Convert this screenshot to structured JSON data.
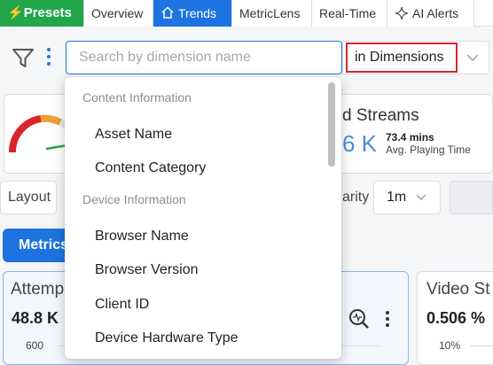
{
  "tabs": {
    "presets": "Presets",
    "overview": "Overview",
    "trends": "Trends",
    "metriclens": "MetricLens",
    "realtime": "Real-Time",
    "aialerts": "AI Alerts"
  },
  "filter": {
    "search_placeholder": "Search by dimension name",
    "search_value": "",
    "scope": "in Dimensions"
  },
  "dropdown": {
    "groups": [
      {
        "label": "Content Information",
        "items": [
          "Asset Name",
          "Content Category"
        ]
      },
      {
        "label": "Device Information",
        "items": [
          "Browser Name",
          "Browser Version",
          "Client ID",
          "Device Hardware Type"
        ]
      }
    ]
  },
  "summary": {
    "streams_title_partial": "d Streams",
    "streams_value_partial": "6 K",
    "playing_time_value": "73.4 mins",
    "playing_time_label": "Avg. Playing Time"
  },
  "toolbar": {
    "layout_label": "Layout",
    "granularity_label_partial": "arity",
    "granularity_value": "1m"
  },
  "metrics_button": "Metrics",
  "cards": [
    {
      "title_partial": "Attemp",
      "value": "48.8 K",
      "tick": "600"
    },
    {
      "title_partial": "Video St",
      "value": "0.506 %",
      "tick": "10%"
    }
  ],
  "colors": {
    "presets_green": "#21a64a",
    "accent_blue": "#1d74e0",
    "highlight_red": "#d9252a",
    "gauge_red": "#d9252a",
    "gauge_orange": "#f0a030",
    "gauge_green": "#21a64a"
  }
}
